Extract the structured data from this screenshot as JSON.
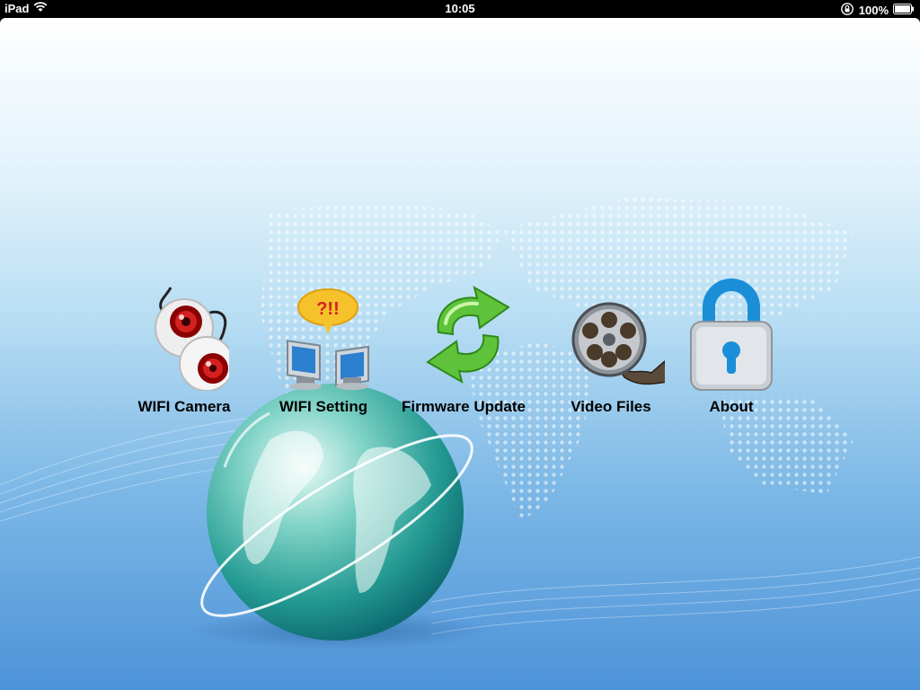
{
  "status_bar": {
    "device": "iPad",
    "time": "10:05",
    "battery": "100%",
    "icons": [
      "wifi-icon",
      "rotation-lock-icon",
      "battery-icon"
    ]
  },
  "menu": {
    "items": [
      {
        "label": "WIFI Camera",
        "icon": "camera-icon"
      },
      {
        "label": "WIFI Setting",
        "icon": "network-icon",
        "badge": "?!!"
      },
      {
        "label": "Firmware Update",
        "icon": "refresh-icon"
      },
      {
        "label": "Video Files",
        "icon": "film-reel-icon"
      },
      {
        "label": "About",
        "icon": "lock-icon"
      }
    ]
  },
  "colors": {
    "status_bar": "#000000",
    "background_top": "#ffffff",
    "background_bottom": "#4d93d9",
    "label_text": "#000000"
  }
}
